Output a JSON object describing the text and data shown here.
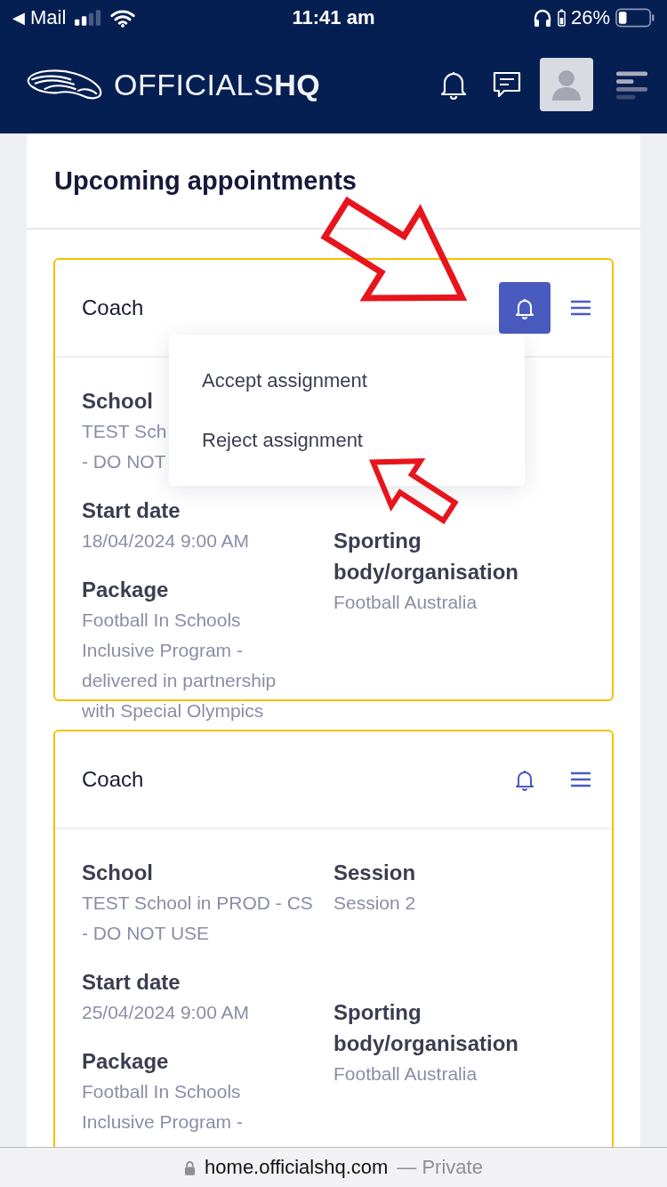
{
  "status_bar": {
    "back_arrow": "◀",
    "back_app": "Mail",
    "time": "11:41 am",
    "battery": "26%"
  },
  "header": {
    "logo_text": "OFFICIALS**HQ**"
  },
  "section": {
    "title": "Upcoming appointments"
  },
  "cards": [
    {
      "title": "Coach",
      "bell_active": true,
      "menu": {
        "items": [
          "Accept assignment",
          "Reject assignment"
        ]
      },
      "fields": [
        {
          "kind": "school",
          "label": "School",
          "value": "TEST Sch\n- DO NOT"
        },
        {
          "kind": "start_date",
          "label": "Start date",
          "value": "18/04/2024 9:00 AM"
        },
        {
          "kind": "sporting_body",
          "label": "Sporting\nbody/organisation",
          "value": "Football Australia"
        },
        {
          "kind": "package",
          "label": "Package",
          "value": "Football In Schools\nInclusive Program -\ndelivered in partnership\nwith Special Olympics"
        }
      ]
    },
    {
      "title": "Coach",
      "bell_active": false,
      "fields": [
        {
          "kind": "school",
          "label": "School",
          "value": "TEST School in PROD - CS\n- DO NOT USE"
        },
        {
          "kind": "session",
          "label": "Session",
          "value": "Session 2"
        },
        {
          "kind": "start_date",
          "label": "Start date",
          "value": "25/04/2024 9:00 AM"
        },
        {
          "kind": "sporting_body",
          "label": "Sporting\nbody/organisation",
          "value": "Football Australia"
        },
        {
          "kind": "package",
          "label": "Package",
          "value": "Football In Schools\nInclusive Program -"
        }
      ]
    }
  ],
  "browser_bar": {
    "url": "home.officialshq.com",
    "suffix": "— Private"
  }
}
